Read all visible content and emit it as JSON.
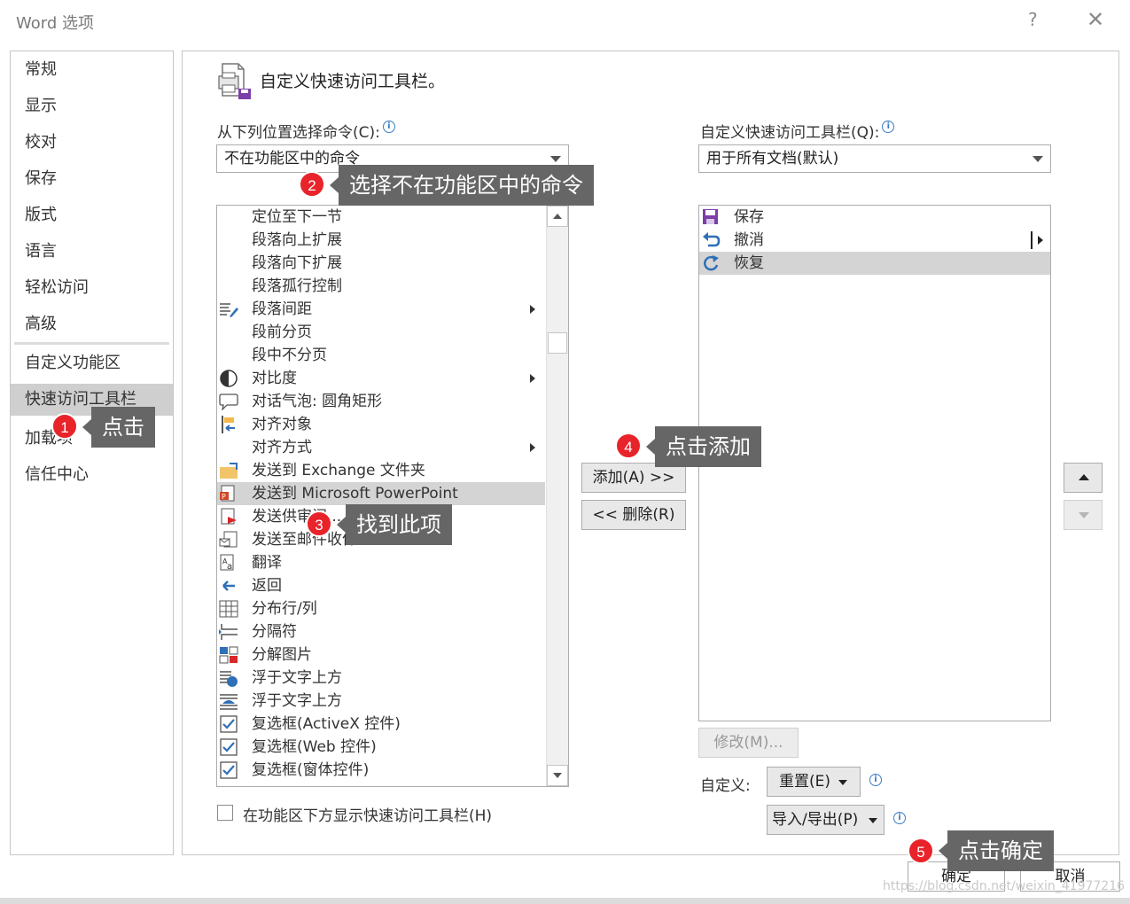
{
  "window": {
    "title": "Word 选项",
    "help_glyph": "?",
    "close_glyph": "✕"
  },
  "nav": {
    "items": [
      {
        "label": "常规"
      },
      {
        "label": "显示"
      },
      {
        "label": "校对"
      },
      {
        "label": "保存"
      },
      {
        "label": "版式"
      },
      {
        "label": "语言"
      },
      {
        "label": "轻松访问"
      },
      {
        "label": "高级"
      },
      {
        "label": "自定义功能区"
      },
      {
        "label": "快速访问工具栏",
        "selected": true
      },
      {
        "label": "加载项"
      },
      {
        "label": "信任中心"
      }
    ]
  },
  "header": {
    "title": "自定义快速访问工具栏。"
  },
  "left_panel": {
    "label": "从下列位置选择命令(C):",
    "combo_value": "不在功能区中的命令",
    "commands": [
      {
        "label": "定位至下一节",
        "icon": "none"
      },
      {
        "label": "段落向上扩展",
        "icon": "none"
      },
      {
        "label": "段落向下扩展",
        "icon": "none"
      },
      {
        "label": "段落孤行控制",
        "icon": "none"
      },
      {
        "label": "段落间距",
        "icon": "paragraph-spacing-icon",
        "submenu": true
      },
      {
        "label": "段前分页",
        "icon": "none"
      },
      {
        "label": "段中不分页",
        "icon": "none"
      },
      {
        "label": "对比度",
        "icon": "contrast-icon",
        "submenu": true
      },
      {
        "label": "对话气泡: 圆角矩形",
        "icon": "speech-bubble-icon"
      },
      {
        "label": "对齐对象",
        "icon": "align-objects-icon"
      },
      {
        "label": "对齐方式",
        "icon": "none",
        "submenu": true
      },
      {
        "label": "发送到 Exchange 文件夹",
        "icon": "exchange-folder-icon"
      },
      {
        "label": "发送到 Microsoft PowerPoint",
        "icon": "powerpoint-send-icon",
        "highlighted": true
      },
      {
        "label": "发送供审阅...",
        "icon": "send-review-icon"
      },
      {
        "label": "发送至邮件收件人",
        "icon": "mail-recipient-icon"
      },
      {
        "label": "翻译",
        "icon": "translate-icon"
      },
      {
        "label": "返回",
        "icon": "back-arrow-icon"
      },
      {
        "label": "分布行/列",
        "icon": "distribute-rows-icon"
      },
      {
        "label": "分隔符",
        "icon": "separator-icon"
      },
      {
        "label": "分解图片",
        "icon": "ungroup-picture-icon"
      },
      {
        "label": "浮于文字上方",
        "icon": "float-above-text-icon"
      },
      {
        "label": "浮于文字上方",
        "icon": "float-above-text-2-icon"
      },
      {
        "label": "复选框(ActiveX 控件)",
        "icon": "checkbox-icon"
      },
      {
        "label": "复选框(Web 控件)",
        "icon": "checkbox-icon"
      },
      {
        "label": "复选框(窗体控件)",
        "icon": "checkbox-icon"
      }
    ],
    "show_below_label": "在功能区下方显示快速访问工具栏(H)"
  },
  "middle": {
    "add_label": "添加(A) >>",
    "remove_label": "<< 删除(R)"
  },
  "right_panel": {
    "label": "自定义快速访问工具栏(Q):",
    "combo_value": "用于所有文档(默认)",
    "items": [
      {
        "label": "保存",
        "icon": "save-icon"
      },
      {
        "label": "撤消",
        "icon": "undo-icon"
      },
      {
        "label": "恢复",
        "icon": "redo-icon",
        "selected": true
      }
    ],
    "modify_label": "修改(M)...",
    "customize_label": "自定义:",
    "reset_label": "重置(E)",
    "import_export_label": "导入/导出(P)"
  },
  "footer": {
    "ok_label": "确定",
    "cancel_label": "取消"
  },
  "annotations": [
    {
      "num": "1",
      "text": "点击"
    },
    {
      "num": "2",
      "text": "选择不在功能区中的命令"
    },
    {
      "num": "3",
      "text": "找到此项"
    },
    {
      "num": "4",
      "text": "点击添加"
    },
    {
      "num": "5",
      "text": "点击确定"
    }
  ],
  "watermark": "https://blog.csdn.net/weixin_41977216",
  "colors": {
    "badge": "#e8232a",
    "callout": "#666666",
    "selection": "#d4d4d4",
    "info_blue": "#3b7cc4"
  }
}
